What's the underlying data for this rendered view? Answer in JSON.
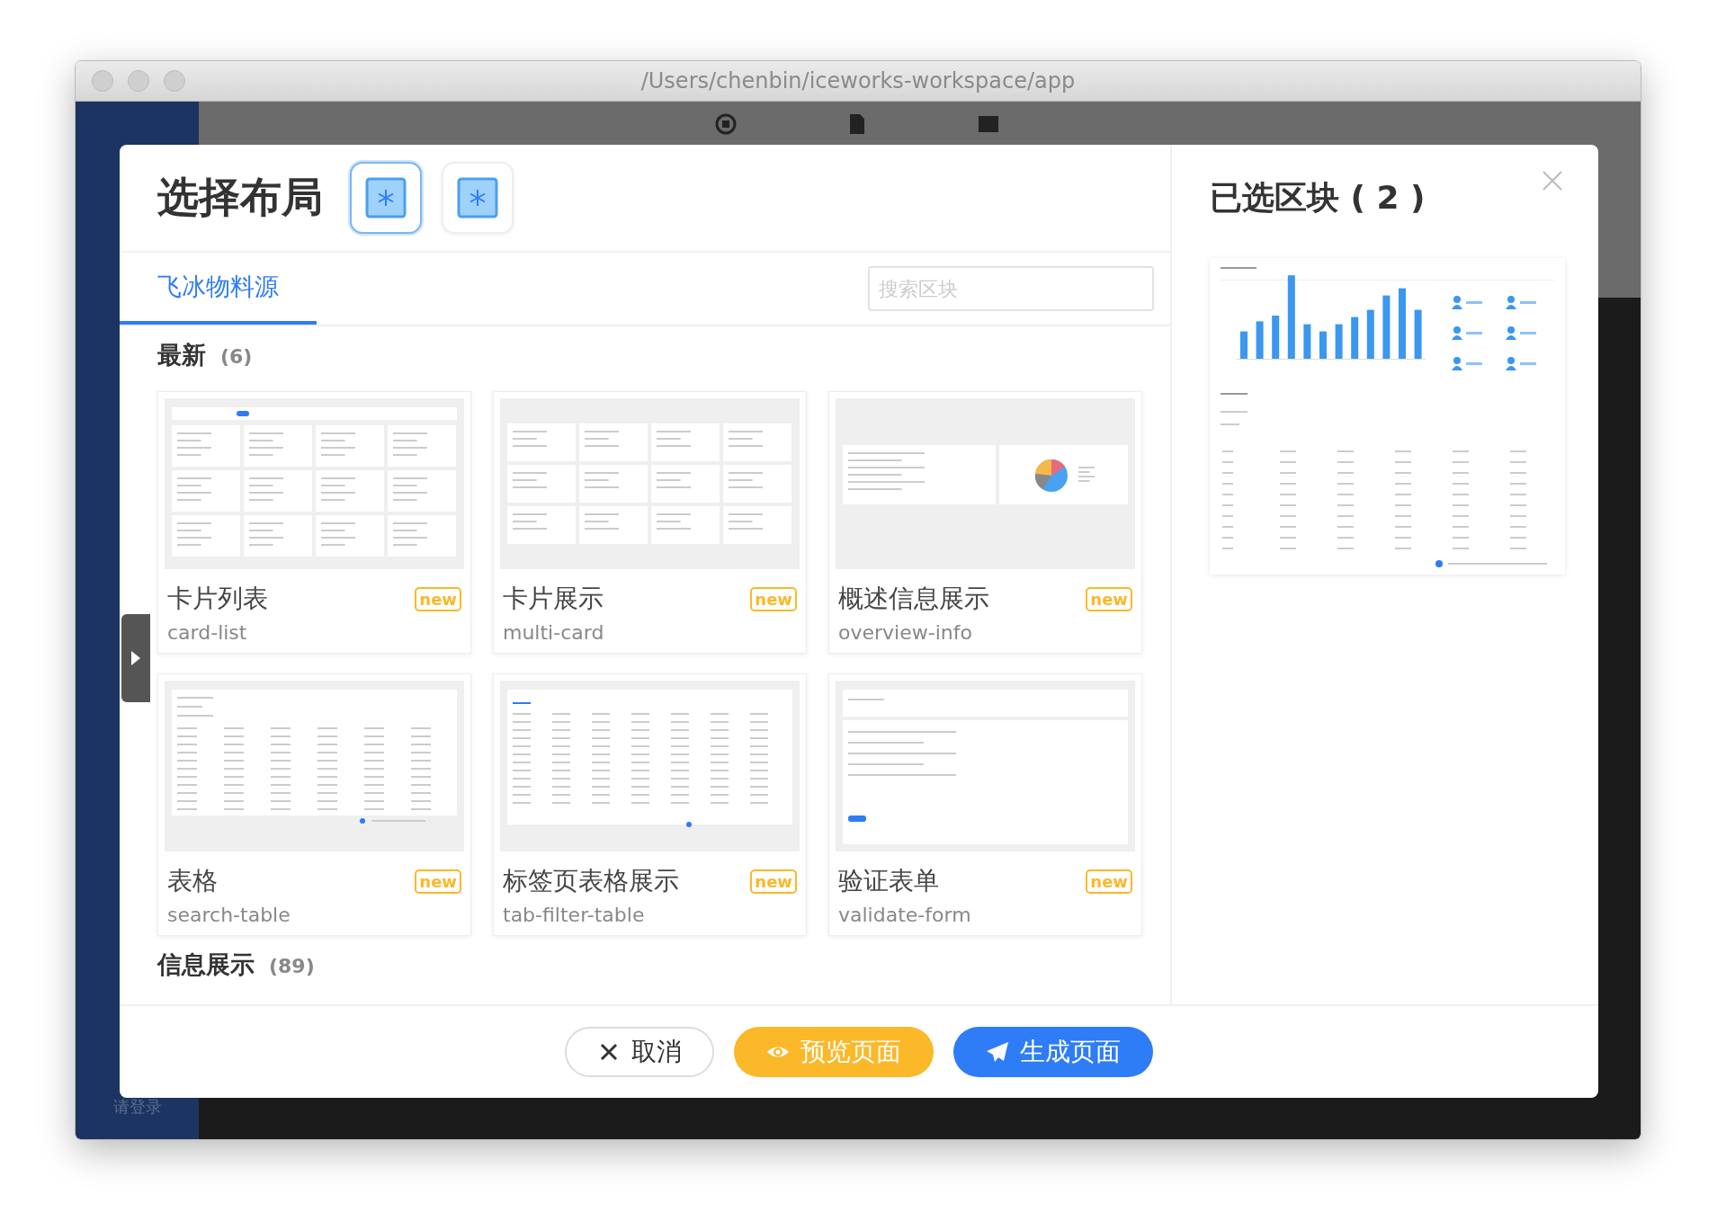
{
  "window": {
    "title": "/Users/chenbin/iceworks-workspace/app"
  },
  "app_sidebar": {
    "login_label": "请登录"
  },
  "dialog": {
    "title": "选择布局",
    "layout_options": [
      {
        "selected": true
      },
      {
        "selected": false
      }
    ],
    "tabs": [
      {
        "label": "飞冰物料源",
        "selected": true
      }
    ],
    "search": {
      "placeholder": "搜索区块"
    },
    "sections": [
      {
        "title": "最新",
        "count": "(6)",
        "blocks": [
          {
            "title": "卡片列表",
            "name": "card-list",
            "badge": "new",
            "kind": "card-grid"
          },
          {
            "title": "卡片展示",
            "name": "multi-card",
            "badge": "new",
            "kind": "multi-card"
          },
          {
            "title": "概述信息展示",
            "name": "overview-info",
            "badge": "new",
            "kind": "overview"
          },
          {
            "title": "表格",
            "name": "search-table",
            "badge": "new",
            "kind": "table"
          },
          {
            "title": "标签页表格展示",
            "name": "tab-filter-table",
            "badge": "new",
            "kind": "tab-table"
          },
          {
            "title": "验证表单",
            "name": "validate-form",
            "badge": "new",
            "kind": "form"
          }
        ]
      },
      {
        "title": "信息展示",
        "count": "(89)"
      }
    ],
    "selected_panel": {
      "title": "已选区块 ( 2 )",
      "previews": [
        {
          "kind": "chart-table"
        }
      ]
    },
    "buttons": [
      {
        "label": "取消",
        "kind": "cancel"
      },
      {
        "label": "预览页面",
        "kind": "preview"
      },
      {
        "label": "生成页面",
        "kind": "generate"
      }
    ]
  }
}
